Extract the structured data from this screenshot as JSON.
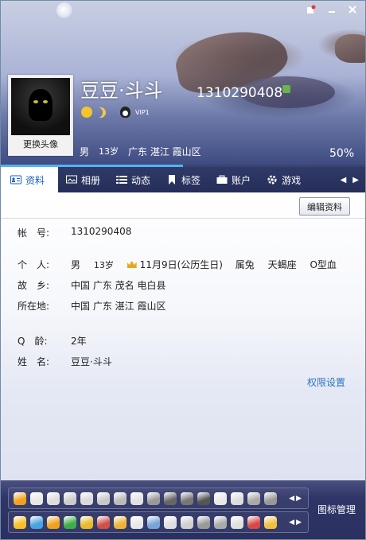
{
  "window": {
    "controls": [
      "skin-icon",
      "minimize-icon",
      "close-icon"
    ]
  },
  "profile": {
    "avatar_change_label": "更换头像",
    "name": "豆豆·斗斗",
    "qq_number": "1310290408",
    "vip_label": "VIP1",
    "gender": "男",
    "age": "13岁",
    "location": "广东 湛江 霞山区",
    "completeness": "50%",
    "completeness_value": 0.5
  },
  "tabs": [
    {
      "label": "资料",
      "icon": "id-card-icon",
      "active": true
    },
    {
      "label": "相册",
      "icon": "photo-album-icon",
      "active": false
    },
    {
      "label": "动态",
      "icon": "feed-list-icon",
      "active": false
    },
    {
      "label": "标签",
      "icon": "bookmark-tag-icon",
      "active": false
    },
    {
      "label": "账户",
      "icon": "wallet-icon",
      "active": false
    },
    {
      "label": "游戏",
      "icon": "game-gear-icon",
      "active": false
    }
  ],
  "details": {
    "edit_button": "编辑资料",
    "account": {
      "label": "帐　号:",
      "value": "1310290408"
    },
    "personal": {
      "label": "个　人:",
      "gender": "男",
      "age": "13岁",
      "birthday": "11月9日(公历生日)",
      "zodiac": "属兔",
      "constellation": "天蝎座",
      "blood_type": "O型血"
    },
    "hometown": {
      "label": "故　乡:",
      "value": "中国 广东 茂名 电白县"
    },
    "location": {
      "label": "所在地:",
      "value": "中国 广东 湛江 霞山区"
    },
    "q_age": {
      "label": "Q　龄:",
      "value": "2年"
    },
    "fullname": {
      "label": "姓　名:",
      "value": "豆豆·斗斗"
    },
    "permission_link": "权限设置"
  },
  "bottom": {
    "manage_label": "图标管理",
    "row1_colors": [
      "#f0a21e",
      "#e8e8e8",
      "#ddd",
      "#ccc",
      "#d9d9d9",
      "#c8c8c8",
      "#bbb",
      "#e2e2e2",
      "#999",
      "#666",
      "#777",
      "#555",
      "#e8e8e8",
      "#ddd",
      "#aaa",
      "#999"
    ],
    "row2_colors": [
      "#f6c02a",
      "#4aa3e0",
      "#f0a21e",
      "#3fae46",
      "#e8b92a",
      "#d0504a",
      "#f0b33a",
      "#e8e8e8",
      "#7aa3d8",
      "#e0e0e0",
      "#cfcfcf",
      "#999",
      "#aaa",
      "#e0e0e0",
      "#d84848",
      "#f0c040"
    ]
  }
}
